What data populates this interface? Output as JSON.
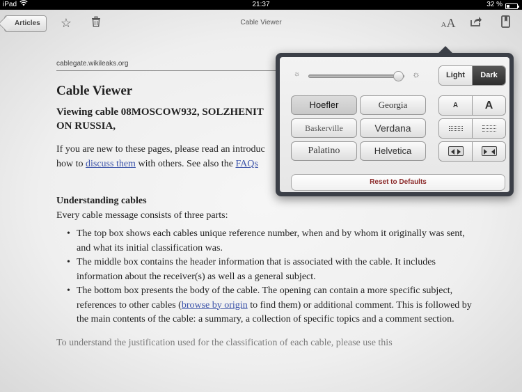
{
  "status_bar": {
    "device": "iPad",
    "time": "21:37",
    "battery": "32 %",
    "battery_level": 0.32
  },
  "toolbar": {
    "back_label": "Articles",
    "title": "Cable Viewer",
    "font_size_icon_label": "AA"
  },
  "article": {
    "source": "cablegate.wikileaks.org",
    "title": "Cable Viewer",
    "subtitle": "Viewing cable 08MOSCOW932, SOLZHENIT ON RUSSIA,",
    "intro_1": "If you are new to these pages, please read an introduc",
    "intro_2": "how to ",
    "intro_link_1": "discuss them",
    "intro_3": " with others. See also the ",
    "intro_link_2": "FAQs",
    "section_title": "Understanding cables",
    "section_intro": "Every cable message consists of three parts:",
    "bullets": [
      {
        "text": "The top box shows each cables unique reference number, when and by whom it originally was sent, and what its initial classification was."
      },
      {
        "text": "The middle box contains the header information that is associated with the cable. It includes information about the receiver(s) as well as a general subject."
      },
      {
        "text_before": "The bottom box presents the body of the cable. The opening can contain a more specific subject, references to other cables (",
        "link": "browse by origin",
        "text_after": " to find them) or additional comment. This is followed by the main contents of the cable: a summary, a collection of specific topics and a comment section."
      }
    ],
    "trailing": "To understand the justification used for the classification of each cable, please use this"
  },
  "popover": {
    "brightness": 0.95,
    "theme_light": "Light",
    "theme_dark": "Dark",
    "fonts": [
      "Hoefler",
      "Georgia",
      "Baskerville",
      "Verdana",
      "Palatino",
      "Helvetica"
    ],
    "selected_font": "Hoefler",
    "font_smaller": "A",
    "font_larger": "A",
    "reset_label": "Reset to Defaults"
  }
}
